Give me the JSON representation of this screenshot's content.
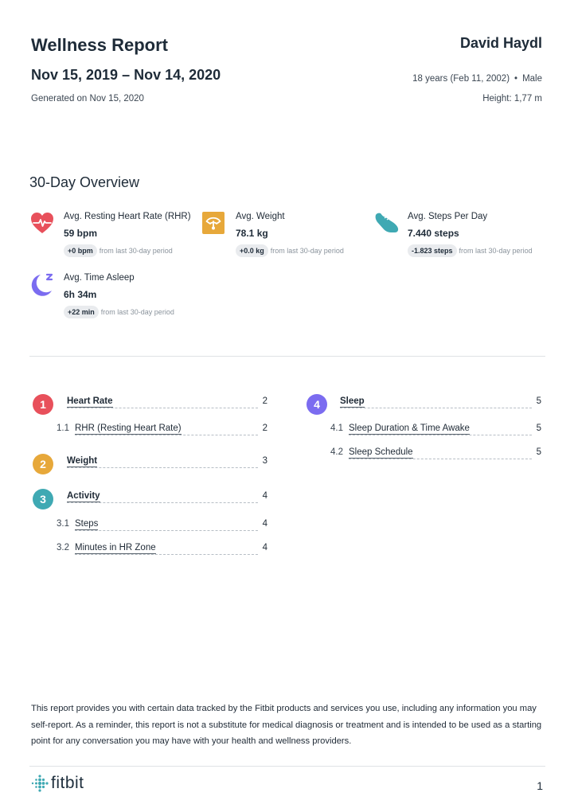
{
  "header": {
    "title": "Wellness Report",
    "date_range": "Nov 15, 2019 – Nov 14, 2020",
    "generated": "Generated on Nov 15, 2020",
    "user_name": "David Haydl",
    "age": "18 years (Feb 11, 2002)",
    "separator": "•",
    "sex": "Male",
    "height": "Height: 1,77 m"
  },
  "overview": {
    "title": "30-Day Overview",
    "metrics": [
      {
        "icon": "heart-rate-icon",
        "label": "Avg. Resting Heart Rate (RHR)",
        "value": "59 bpm",
        "delta": "+0 bpm",
        "delta_suffix": "from last 30-day period",
        "color": "#e8505b"
      },
      {
        "icon": "scale-icon",
        "label": "Avg. Weight",
        "value": "78.1 kg",
        "delta": "+0.0 kg",
        "delta_suffix": "from last 30-day period",
        "color": "#e7a83a"
      },
      {
        "icon": "shoe-icon",
        "label": "Avg. Steps Per Day",
        "value": "7.440 steps",
        "delta": "-1.823 steps",
        "delta_suffix": "from last 30-day period",
        "color": "#3fa9b3"
      },
      {
        "icon": "moon-icon",
        "label": "Avg. Time Asleep",
        "value": "6h 34m",
        "delta": "+22 min",
        "delta_suffix": "from last 30-day period",
        "color": "#7b6cf0"
      }
    ]
  },
  "toc": {
    "sections": [
      {
        "number": "1",
        "title": "Heart Rate",
        "page": "2",
        "color": "#e8505b",
        "subsections": [
          {
            "number": "1.1",
            "title": "RHR (Resting Heart Rate)",
            "page": "2"
          }
        ]
      },
      {
        "number": "2",
        "title": "Weight",
        "page": "3",
        "color": "#e7a83a",
        "subsections": []
      },
      {
        "number": "3",
        "title": "Activity",
        "page": "4",
        "color": "#3fa9b3",
        "subsections": [
          {
            "number": "3.1",
            "title": "Steps",
            "page": "4"
          },
          {
            "number": "3.2",
            "title": "Minutes in HR Zone",
            "page": "4"
          }
        ]
      },
      {
        "number": "4",
        "title": "Sleep",
        "page": "5",
        "color": "#7b6cf0",
        "subsections": [
          {
            "number": "4.1",
            "title": "Sleep Duration & Time Awake",
            "page": "5"
          },
          {
            "number": "4.2",
            "title": "Sleep Schedule",
            "page": "5"
          }
        ]
      }
    ]
  },
  "footer": {
    "disclaimer": "This report provides you with certain data tracked by the Fitbit products and services you use, including any information you may self-report. As a reminder, this report is not a substitute for medical diagnosis or treatment and is intended to be used as a starting point for any conversation you may have with your health and wellness providers.",
    "logo_text": "fitbit",
    "page_number": "1",
    "brand_color": "#3fa9b3"
  }
}
